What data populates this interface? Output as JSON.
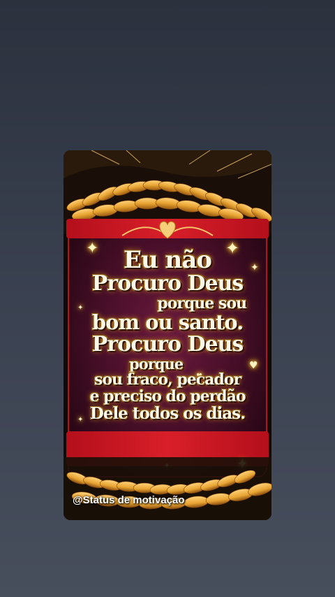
{
  "post": {
    "quote_lines": [
      "Eu não",
      "Procuro Deus",
      "porque sou",
      "bom ou santo.",
      "Procuro Deus",
      "porque",
      "sou fraco, pecador",
      "e preciso do perdão",
      "Dele todos os dias."
    ],
    "watermark": "@Status de motivação"
  },
  "colors": {
    "page_background": "#3a4150",
    "banner_red": "#d81f29",
    "banner_wine": "#4a0f2a",
    "text_gold_glow": "#e0a020",
    "wheat_gold": "#e8a432"
  },
  "icons": [
    "heart-ornament-icon",
    "sparkle-icon",
    "wheat-icon"
  ]
}
